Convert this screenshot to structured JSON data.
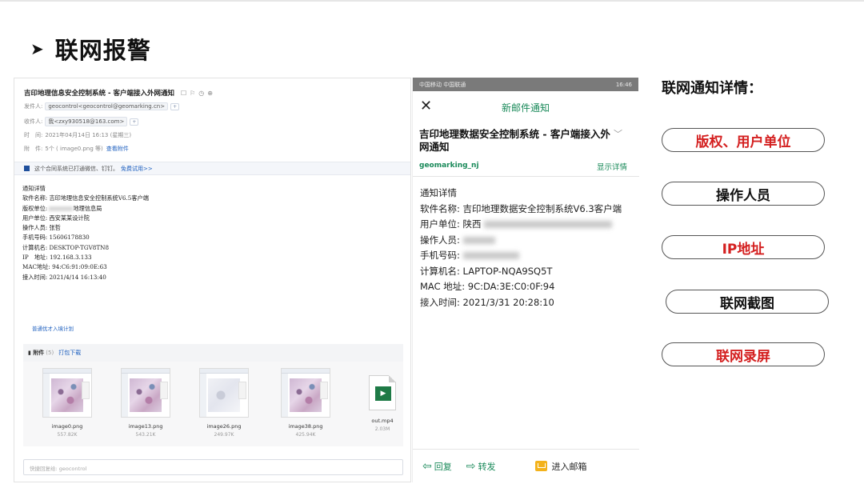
{
  "slide": {
    "heading_arrow": "➤",
    "heading": "联网报警"
  },
  "email": {
    "subject": "吉印地理信息安全控制系统 - 客户端接入外网通知",
    "from_label": "发件人:",
    "from_value": "geocontrol<geocontrol@geomarking.cn>",
    "to_label": "收件人:",
    "to_value": "我<zxy930518@163.com>",
    "time_label": "时　间:",
    "time_value": "2021年04月14日 16:13 (星期三)",
    "attach_label": "附　件:",
    "attach_value": "5个 ( image0.png 等)",
    "view_attach": "查看附件",
    "notice": "这个合同系统已打通微信、钉钉。",
    "notice_link": "免费试用>>",
    "body_lines": [
      "通知详情",
      "软件名称: 吉印地理信息安全控制系统V6.5客户端",
      "用户单位: 西安某某设计院",
      "操作人员: 张哲",
      "手机号码: 15606178830",
      "计算机名: DESKTOP-TGV8TN8",
      "IP　地址: 192.168.3.133",
      "MAC地址: 94:C6:91:09:0E:63",
      "接入时间: 2021/4/14 16:13:40"
    ],
    "copyright_prefix": "版权单位:",
    "copyright_suffix": "地理信息局",
    "summary_link": "普通优才入境计划",
    "attachments_label": "附件",
    "attachments_count": "(5)",
    "pack_download": "打包下载",
    "attachments": [
      {
        "name": "image0.png",
        "size": "557.82K"
      },
      {
        "name": "image13.png",
        "size": "543.21K"
      },
      {
        "name": "image26.png",
        "size": "249.97K"
      },
      {
        "name": "image38.png",
        "size": "425.94K"
      },
      {
        "name": "out.mp4",
        "size": "2.03M"
      }
    ],
    "reply_placeholder": "快捷回复给: geocontrol"
  },
  "phone": {
    "status_left": "中国移动 中国联通",
    "status_right": "16:46",
    "nav_title": "新邮件通知",
    "close_icon": "✕",
    "title": "吉印地理数据安全控制系统 - 客户端接入外网通知",
    "sender": "geomarking_nj",
    "show_details": "显示详情",
    "lines": [
      "通知详情",
      "软件名称: 吉印地理数据安全控制系统V6.3客户端",
      "用户单位: 陕西",
      "操作人员:",
      "手机号码:",
      "计算机名: LAPTOP-NQA9SQ5T",
      "MAC 地址: 9C:DA:3E:C0:0F:94",
      "接入时间: 2021/3/31 20:28:10"
    ],
    "reply": "回复",
    "forward": "转发",
    "enter_mailbox": "进入邮箱"
  },
  "right": {
    "title": "联网通知详情：",
    "items": [
      "版权、用户单位",
      "操作人员",
      "IP地址",
      "联网截图",
      "联网录屏"
    ],
    "colors": [
      "#d41f1f",
      "#111111",
      "#d41f1f",
      "#111111",
      "#d41f1f"
    ]
  }
}
